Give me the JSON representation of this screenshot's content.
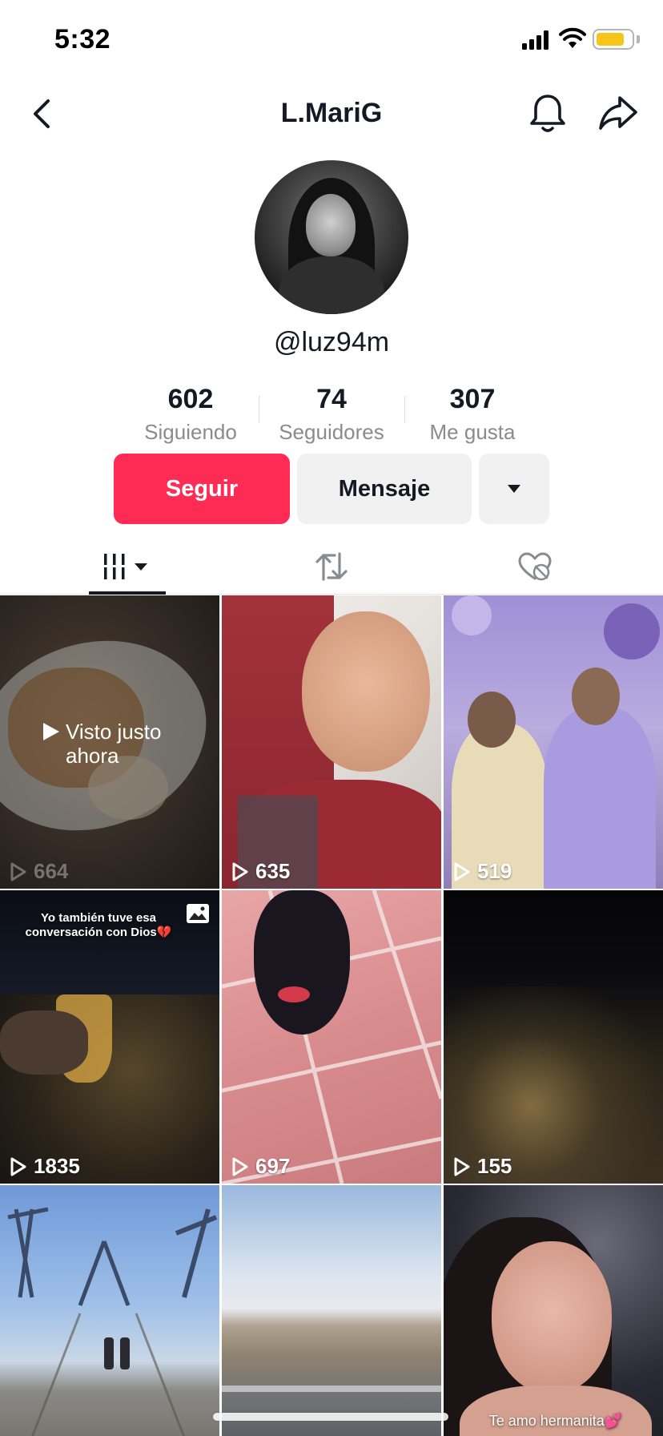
{
  "status_bar": {
    "time": "5:32",
    "battery_color": "#f5c518"
  },
  "nav": {
    "title": "L.MariG",
    "icons": [
      "chevron-left-icon",
      "bell-icon",
      "share-icon"
    ]
  },
  "profile": {
    "handle": "@luz94m",
    "stats": [
      {
        "value": "602",
        "label": "Siguiendo"
      },
      {
        "value": "74",
        "label": "Seguidores"
      },
      {
        "value": "307",
        "label": "Me gusta"
      }
    ]
  },
  "actions": {
    "follow_label": "Seguir",
    "message_label": "Mensaje",
    "follow_color": "#fe2c55"
  },
  "tabs": [
    {
      "name": "videos",
      "icon": "grid-icon",
      "active": true
    },
    {
      "name": "reposts",
      "icon": "repost-icon",
      "active": false
    },
    {
      "name": "liked",
      "icon": "hidden-heart-icon",
      "active": false
    }
  ],
  "videos": [
    {
      "views": "664",
      "watched_label": "Visto justo ahora"
    },
    {
      "views": "635"
    },
    {
      "views": "519"
    },
    {
      "views": "1835",
      "caption": "Yo también tuve esa conversación con Dios💔",
      "badge": "photo-icon"
    },
    {
      "views": "697"
    },
    {
      "views": "155"
    },
    {
      "views": ""
    },
    {
      "views": ""
    },
    {
      "views": "",
      "caption": "Te amo hermanita💕"
    }
  ]
}
